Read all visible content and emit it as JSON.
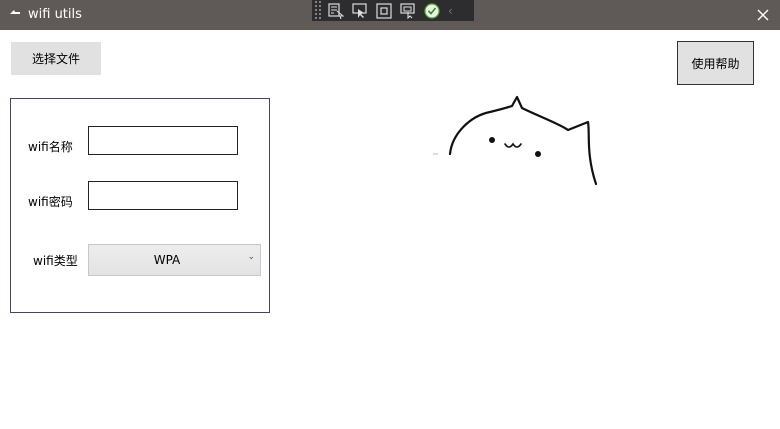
{
  "window": {
    "title": "wifi utils",
    "icon": "app-icon",
    "close_glyph": "✕"
  },
  "debug_toolbar": {
    "icons": [
      "select-element-icon",
      "pointer-select-icon",
      "layout-adorner-icon",
      "track-focus-icon",
      "binding-check-icon"
    ],
    "collapse_glyph": "‹"
  },
  "buttons": {
    "select_file": "选择文件",
    "help": "使用帮助"
  },
  "form": {
    "name_label": "wifi名称",
    "name_value": "",
    "password_label": "wifi密码",
    "password_value": "",
    "type_label": "wifi类型",
    "type_value": "WPA",
    "type_arrow": "⌄"
  },
  "colors": {
    "titlebar": "#5f5a57",
    "toolbar": "#2d2d30",
    "button": "#e1e1e1",
    "group_border": "#4a3d7a"
  }
}
